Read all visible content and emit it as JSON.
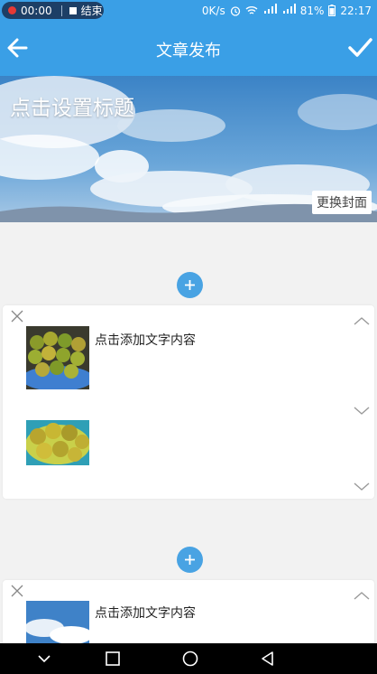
{
  "status_bar": {
    "recording_time": "00:00",
    "stop_label": "结束",
    "net_speed": "0K/s",
    "signal_1": "3G",
    "signal_2": "4G",
    "battery": "81%",
    "clock": "22:17"
  },
  "app_bar": {
    "title": "文章发布",
    "back_icon": "arrow-left-icon",
    "confirm_icon": "check-icon"
  },
  "cover": {
    "title_placeholder": "点击设置标题",
    "change_cover_label": "更换封面"
  },
  "add_button_icon": "plus-icon",
  "cards": [
    {
      "items": [
        {
          "image": "oranges-bowl",
          "text": "点击添加文字内容"
        },
        {
          "image": "oranges-plate",
          "text": ""
        }
      ]
    },
    {
      "items": [
        {
          "image": "sky",
          "text": "点击添加文字内容"
        }
      ]
    }
  ],
  "nav_bar": {
    "icons": [
      "chevron-down-icon",
      "square-icon",
      "circle-icon",
      "triangle-back-icon"
    ]
  },
  "colors": {
    "accent": "#3a9fe6",
    "add_button": "#49a3e3",
    "background": "#f2f2f2"
  }
}
